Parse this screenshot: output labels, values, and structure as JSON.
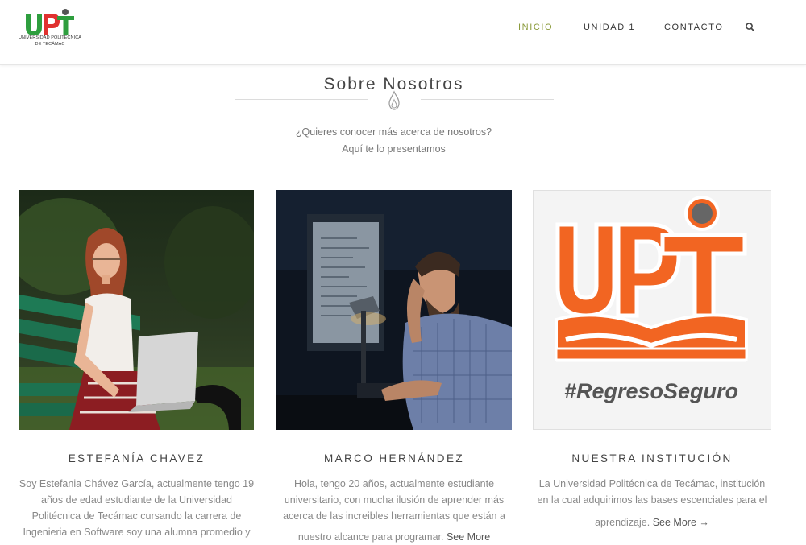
{
  "header": {
    "logo_letters": "UPT",
    "logo_caption_line1": "UNIVERSIDAD POLITÉCNICA",
    "logo_caption_line2": "DE TECÁMAC",
    "nav": {
      "inicio": "INICIO",
      "unidad1": "UNIDAD 1",
      "contacto": "CONTACTO"
    },
    "search_icon": "search-icon",
    "active_color": "#8a9a3a"
  },
  "section": {
    "title": "Sobre Nosotros",
    "divider_icon": "flame-icon",
    "intro_line1": "¿Quieres conocer más acerca de nosotros?",
    "intro_line2": "Aquí te lo presentamos"
  },
  "cards": [
    {
      "title": "ESTEFANÍA CHAVEZ",
      "image": "student-laptop-photo",
      "lines": [
        "Soy Estefania Chávez García, actualmente tengo 19",
        "años de edad estudiante de la Universidad",
        "Politécnica de Tecámac cursando la carrera de",
        "Ingenieria en Software soy una alumna promedio y"
      ]
    },
    {
      "title": "MARCO HERNÁNDEZ",
      "image": "student-computer-photo",
      "lines": [
        "Hola, tengo 20 años, actualmente estudiante",
        "universitario, con mucha ilusión de aprender más",
        "acerca de las increibles herramientas que están a",
        "nuestro alcance para programar."
      ],
      "see_more": "See More"
    },
    {
      "title": "NUESTRA INSTITUCIÓN",
      "image": "upt-logo-image",
      "image_logo_text": "UPT",
      "image_hashtag": "#RegresoSeguro",
      "lines": [
        "La Universidad Politécnica de Tecámac, institución",
        "en la cual adquirimos las bases escenciales para el",
        "aprendizaje."
      ],
      "see_more": "See More →"
    }
  ],
  "colors": {
    "upt_orange": "#f26522",
    "upt_green": "#2e9e3e",
    "upt_red": "#e0312f"
  }
}
